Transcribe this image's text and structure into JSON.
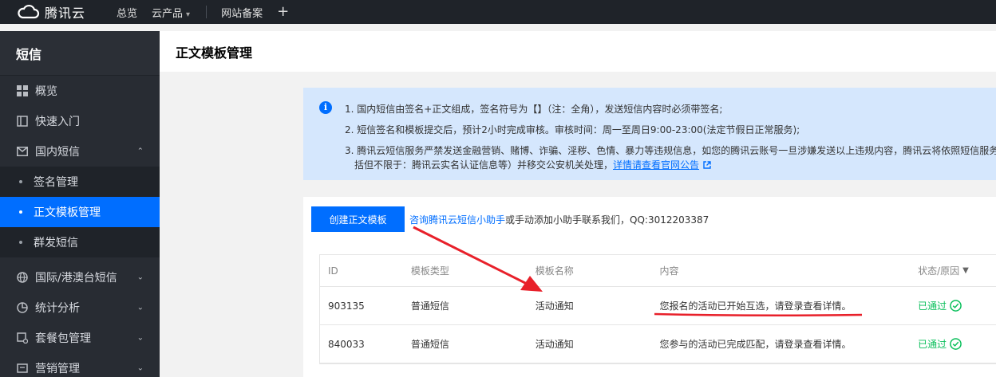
{
  "topbar": {
    "brand": "腾讯云",
    "nav": [
      "总览",
      "云产品",
      "网站备案"
    ],
    "plus": "+"
  },
  "sidebar": {
    "title": "短信",
    "items": [
      {
        "label": "概览",
        "icon": "grid-icon"
      },
      {
        "label": "快速入门",
        "icon": "book-icon"
      },
      {
        "label": "国内短信",
        "icon": "mail-icon",
        "expanded": true
      }
    ],
    "subitems": [
      {
        "label": "签名管理",
        "active": false
      },
      {
        "label": "正文模板管理",
        "active": true
      },
      {
        "label": "群发短信",
        "active": false
      }
    ],
    "more": [
      {
        "label": "国际/港澳台短信",
        "icon": "globe-icon"
      },
      {
        "label": "统计分析",
        "icon": "chart-icon"
      },
      {
        "label": "套餐包管理",
        "icon": "package-icon"
      },
      {
        "label": "营销管理",
        "icon": "marketing-icon"
      }
    ]
  },
  "page": {
    "title": "正文模板管理"
  },
  "notice": {
    "line1": "1. 国内短信由签名+正文组成，签名符号为【】（注：全角），发送短信内容时必须带签名;",
    "line2": "2. 短信签名和模板提交后，预计2小时完成审核。审核时间：周一至周日9:00-23:00(法定节假日正常服务);",
    "line3": "3. 腾讯云短信服务严禁发送金融营销、赌博、诈骗、淫秽、色情、暴力等违规信息，如您的腾讯云账号一旦涉嫌发送以上违规内容，腾讯云将依照短信服务",
    "line3b_prefix": "括但不限于：腾讯云实名认证信息等）并移交公安机关处理，",
    "line3b_link": "详情请查看官网公告"
  },
  "toolbar": {
    "create_label": "创建正文模板",
    "tip_link": "咨询腾讯云短信小助手",
    "tip_text": "或手动添加小助手联系我们，QQ:3012203387"
  },
  "table": {
    "headers": [
      "ID",
      "模板类型",
      "模板名称",
      "内容",
      "状态/原因"
    ],
    "rows": [
      {
        "id": "903135",
        "type": "普通短信",
        "name": "活动通知",
        "content": "您报名的活动已开始互选，请登录查看详情。",
        "status": "已通过"
      },
      {
        "id": "840033",
        "type": "普通短信",
        "name": "活动通知",
        "content": "您参与的活动已完成匹配，请登录查看详情。",
        "status": "已通过"
      }
    ]
  },
  "colors": {
    "accent": "#006eff",
    "annotation": "#e8202a",
    "success": "#0abf5b"
  }
}
